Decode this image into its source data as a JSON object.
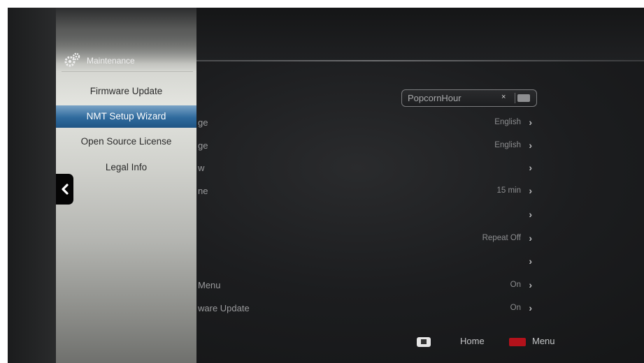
{
  "side_panel": {
    "title": "Maintenance",
    "items": [
      {
        "label": "Firmware Update",
        "selected": false
      },
      {
        "label": "NMT Setup Wizard",
        "selected": true
      },
      {
        "label": "Open Source License",
        "selected": false
      },
      {
        "label": "Legal Info",
        "selected": false
      }
    ]
  },
  "name_field": {
    "value": "PopcornHour",
    "clear_icon": "×"
  },
  "settings": [
    {
      "label_fragment": "",
      "value": ""
    },
    {
      "label_fragment": "ge",
      "value": "English"
    },
    {
      "label_fragment": "ge",
      "value": "English"
    },
    {
      "label_fragment": "w",
      "value": ""
    },
    {
      "label_fragment": "ne",
      "value": "15 min"
    },
    {
      "label_fragment": "",
      "value": ""
    },
    {
      "label_fragment": "",
      "value": "Repeat Off"
    },
    {
      "label_fragment": "",
      "value": ""
    },
    {
      "label_fragment": "Menu",
      "value": "On"
    },
    {
      "label_fragment": "ware Update",
      "value": "On"
    }
  ],
  "footer": {
    "home_label": "Home",
    "menu_label": "Menu"
  },
  "icons": {
    "back": "chevron-left-icon",
    "home": "home-icon",
    "menu": "red-menu-button-icon",
    "gear": "gear-icon",
    "keyboard": "keyboard-icon"
  },
  "colors": {
    "selected_item": "#2f6a9d",
    "menu_button": "#b3121b"
  }
}
